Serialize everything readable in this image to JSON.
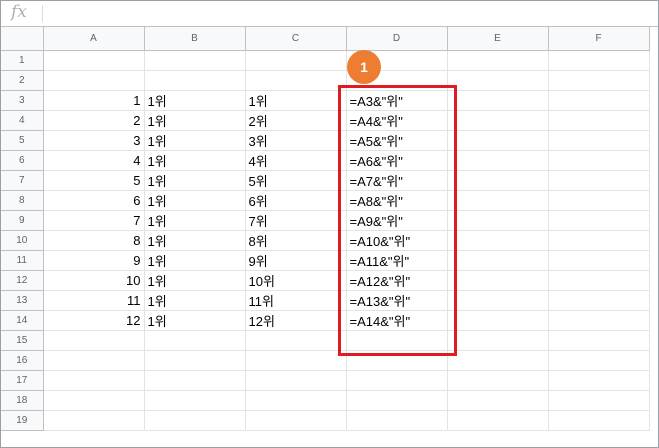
{
  "formula_bar": {
    "icon": "fx",
    "value": ""
  },
  "columns": [
    "A",
    "B",
    "C",
    "D",
    "E",
    "F"
  ],
  "rows": [
    {
      "row": "1",
      "A": "",
      "B": "",
      "C": "",
      "D": ""
    },
    {
      "row": "2",
      "A": "",
      "B": "",
      "C": "",
      "D": ""
    },
    {
      "row": "3",
      "A": "1",
      "B": "1위",
      "C": "1위",
      "D": "=A3&\"위\""
    },
    {
      "row": "4",
      "A": "2",
      "B": "1위",
      "C": "2위",
      "D": "=A4&\"위\""
    },
    {
      "row": "5",
      "A": "3",
      "B": "1위",
      "C": "3위",
      "D": "=A5&\"위\""
    },
    {
      "row": "6",
      "A": "4",
      "B": "1위",
      "C": "4위",
      "D": "=A6&\"위\""
    },
    {
      "row": "7",
      "A": "5",
      "B": "1위",
      "C": "5위",
      "D": "=A7&\"위\""
    },
    {
      "row": "8",
      "A": "6",
      "B": "1위",
      "C": "6위",
      "D": "=A8&\"위\""
    },
    {
      "row": "9",
      "A": "7",
      "B": "1위",
      "C": "7위",
      "D": "=A9&\"위\""
    },
    {
      "row": "10",
      "A": "8",
      "B": "1위",
      "C": "8위",
      "D": "=A10&\"위\""
    },
    {
      "row": "11",
      "A": "9",
      "B": "1위",
      "C": "9위",
      "D": "=A11&\"위\""
    },
    {
      "row": "12",
      "A": "10",
      "B": "1위",
      "C": "10위",
      "D": "=A12&\"위\""
    },
    {
      "row": "13",
      "A": "11",
      "B": "1위",
      "C": "11위",
      "D": "=A13&\"위\""
    },
    {
      "row": "14",
      "A": "12",
      "B": "1위",
      "C": "12위",
      "D": "=A14&\"위\""
    },
    {
      "row": "15",
      "A": "",
      "B": "",
      "C": "",
      "D": ""
    },
    {
      "row": "16",
      "A": "",
      "B": "",
      "C": "",
      "D": ""
    },
    {
      "row": "17",
      "A": "",
      "B": "",
      "C": "",
      "D": ""
    },
    {
      "row": "18",
      "A": "",
      "B": "",
      "C": "",
      "D": ""
    },
    {
      "row": "19",
      "A": "",
      "B": "",
      "C": "",
      "D": ""
    }
  ],
  "annotation": {
    "badge_label": "1",
    "highlight_color": "#e21b22",
    "badge_color": "#ed7d31"
  }
}
